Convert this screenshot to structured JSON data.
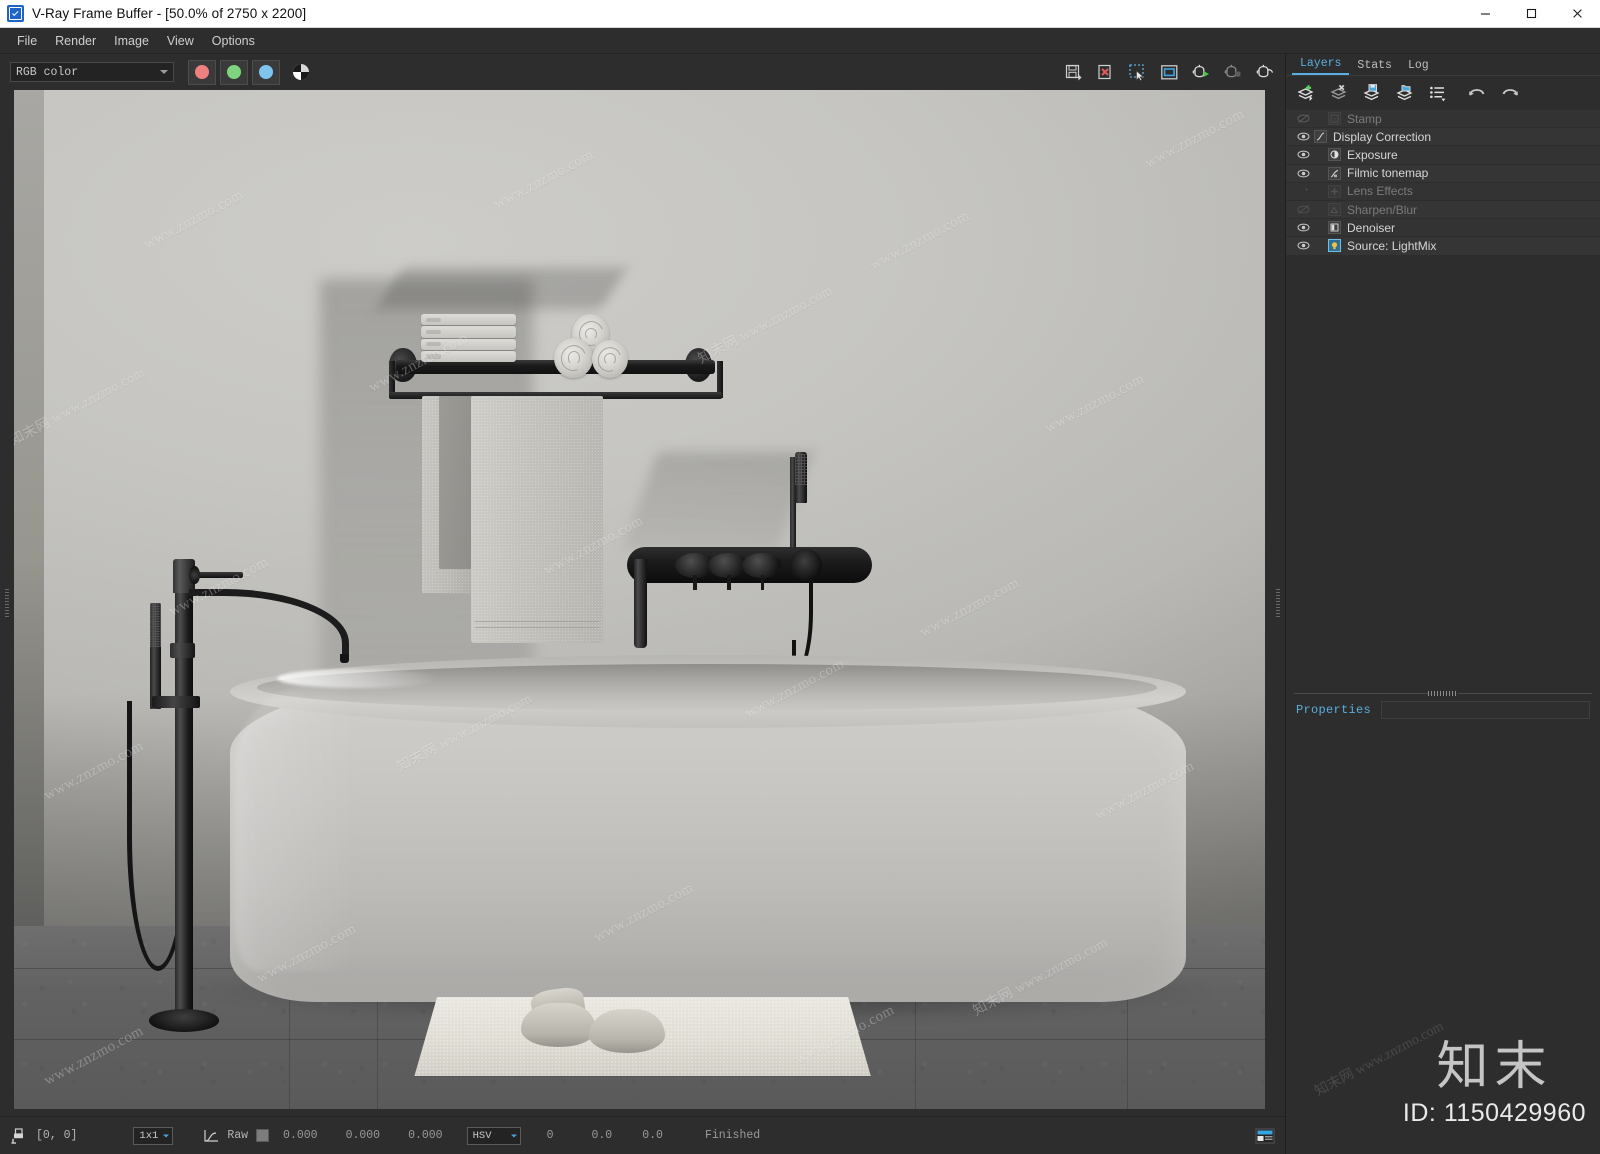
{
  "window": {
    "title": "V-Ray Frame Buffer - [50.0% of 2750 x 2200]",
    "app_icon": "vray-checkbox-icon",
    "minimize_label": "Minimize",
    "maximize_label": "Maximize",
    "close_label": "Close"
  },
  "menubar": {
    "items": [
      {
        "label": "File"
      },
      {
        "label": "Render"
      },
      {
        "label": "Image"
      },
      {
        "label": "View"
      },
      {
        "label": "Options"
      }
    ]
  },
  "channel_toolbar": {
    "channel_select": {
      "value": "RGB color",
      "placeholder": "RGB color"
    },
    "color_buttons": [
      {
        "name": "red-channel-button",
        "color": "#f08080"
      },
      {
        "name": "green-channel-button",
        "color": "#7fd47f"
      },
      {
        "name": "blue-channel-button",
        "color": "#7fc4ee"
      }
    ],
    "monochrome_button": {
      "name": "monochrome-button"
    },
    "right_tools": [
      {
        "name": "save-image-icon",
        "tooltip": "Save current channel"
      },
      {
        "name": "save-all-image-icon",
        "tooltip": "Save all image channels"
      },
      {
        "name": "region-render-icon",
        "tooltip": "Render region"
      },
      {
        "name": "viewport-fit-icon",
        "tooltip": "Fit image in window"
      },
      {
        "name": "render-last-icon",
        "tooltip": "Render last"
      },
      {
        "name": "render-stop-icon",
        "tooltip": "Stop render"
      },
      {
        "name": "render-teapot-icon",
        "tooltip": "Start render"
      }
    ]
  },
  "layers_dock": {
    "tabs": [
      {
        "label": "Layers",
        "active": true
      },
      {
        "label": "Stats",
        "active": false
      },
      {
        "label": "Log",
        "active": false
      }
    ],
    "toolbar": [
      {
        "name": "add-layer-icon",
        "tooltip": "Add layer"
      },
      {
        "name": "delete-layer-icon",
        "tooltip": "Delete layer"
      },
      {
        "name": "save-layers-icon",
        "tooltip": "Save layers"
      },
      {
        "name": "load-layers-icon",
        "tooltip": "Load layers"
      },
      {
        "name": "layer-presets-icon",
        "tooltip": "Presets"
      },
      {
        "name": "undo-icon",
        "tooltip": "Undo"
      },
      {
        "name": "redo-icon",
        "tooltip": "Redo"
      }
    ],
    "layers": [
      {
        "label": "Stamp",
        "visible": false,
        "enabled": false,
        "indent": 1,
        "icon": "stamp-icon"
      },
      {
        "label": "Display Correction",
        "visible": true,
        "enabled": true,
        "indent": 0,
        "icon": "curve-icon"
      },
      {
        "label": "Exposure",
        "visible": true,
        "enabled": true,
        "indent": 1,
        "icon": "exposure-icon"
      },
      {
        "label": "Filmic tonemap",
        "visible": true,
        "enabled": true,
        "indent": 1,
        "icon": "filmic-icon"
      },
      {
        "label": "Lens Effects",
        "visible": false,
        "enabled": false,
        "indent": 1,
        "icon": "lens-plus-icon"
      },
      {
        "label": "Sharpen/Blur",
        "visible": false,
        "enabled": false,
        "indent": 1,
        "icon": "sharpen-icon"
      },
      {
        "label": "Denoiser",
        "visible": true,
        "enabled": true,
        "indent": 1,
        "icon": "denoiser-icon"
      },
      {
        "label": "Source: LightMix",
        "visible": true,
        "enabled": true,
        "indent": 1,
        "icon": "lightmix-icon"
      }
    ],
    "properties": {
      "label": "Properties",
      "field_value": ""
    }
  },
  "statusbar": {
    "lock_icon": "pixel-lock-icon",
    "coords": "[0,  0]",
    "sample_size": {
      "value": "1x1"
    },
    "curve_icon": "curve-icon",
    "raw_label": "Raw",
    "swatch_color": "#7d7d7d",
    "rgb_values": [
      "0.000",
      "0.000",
      "0.000"
    ],
    "color_mode": {
      "value": "HSV"
    },
    "hsv_values": [
      "0",
      "0.0",
      "0.0"
    ],
    "state": "Finished",
    "right_icon": "history-panel-icon"
  },
  "render": {
    "scene_name": "bathroom-interior-render",
    "zoom_percent": "50.0%",
    "resolution": "2750 x 2200",
    "objects": [
      "wall",
      "floor-tiles",
      "freestanding-tub",
      "floor-mounted-tub-filler",
      "wall-mounted-mixer",
      "towel-shelf",
      "folded-towels",
      "rolled-towels",
      "hanging-towels",
      "bath-mat",
      "slippers"
    ],
    "watermark_text": "www.znzmo.com",
    "watermark_cn": "知末网 www.znzmo.com"
  },
  "brand": {
    "name": "知末",
    "id": "ID: 1150429960"
  }
}
